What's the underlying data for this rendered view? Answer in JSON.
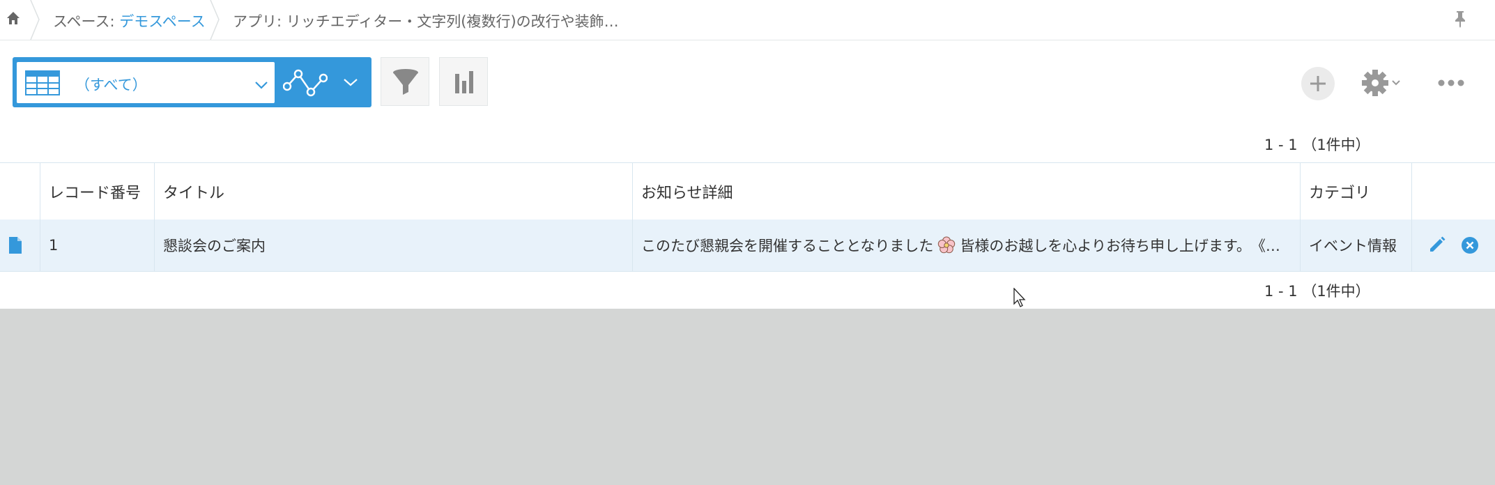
{
  "breadcrumb": {
    "space_prefix": "スペース: ",
    "space_name": "デモスペース",
    "app_label": "アプリ: リッチエディター・文字列(複数行)の改行や装飾…"
  },
  "toolbar": {
    "view_label": "（すべて）",
    "icons": [
      "home-icon",
      "table-view-icon",
      "chevron-down-icon",
      "graph-icon",
      "filter-icon",
      "bar-chart-icon",
      "plus-icon",
      "gear-icon",
      "more-icon",
      "pin-icon"
    ]
  },
  "pager": {
    "top": "1 - 1 （1件中）",
    "bottom": "1 - 1 （1件中）"
  },
  "table": {
    "headers": [
      "レコード番号",
      "タイトル",
      "お知らせ詳細",
      "カテゴリ"
    ],
    "rows": [
      {
        "record_no": "1",
        "title": "懇談会のご案内",
        "detail_before": "このたび懇親会を開催することとなりました",
        "detail_after": "皆様のお越しを心よりお待ち申し上げます。　《…",
        "category": "イベント情報"
      }
    ]
  },
  "colors": {
    "accent": "#3498db",
    "row_highlight": "#e8f2fa",
    "background": "#d4d6d5"
  }
}
